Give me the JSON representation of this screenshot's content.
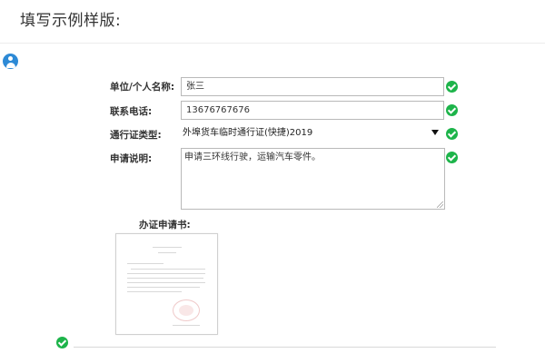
{
  "page": {
    "heading": "填写示例样版:"
  },
  "icons": {
    "user": "user-circle-icon",
    "check": "check-circle-icon",
    "dropdown": "caret-down-icon"
  },
  "colors": {
    "accent_blue": "#2d8ad6",
    "check_green": "#1db44a",
    "border": "#b9b9b9"
  },
  "form": {
    "company": {
      "label": "单位/个人名称:",
      "value": "张三"
    },
    "phone": {
      "label": "联系电话:",
      "value": "13676767676"
    },
    "permit_type": {
      "label": "通行证类型:",
      "selected": "外埠货车临时通行证(快捷)2019"
    },
    "description": {
      "label": "申请说明:",
      "value": "申请三环线行驶，运输汽车零件。"
    }
  },
  "document": {
    "label": "办证申请书:"
  }
}
